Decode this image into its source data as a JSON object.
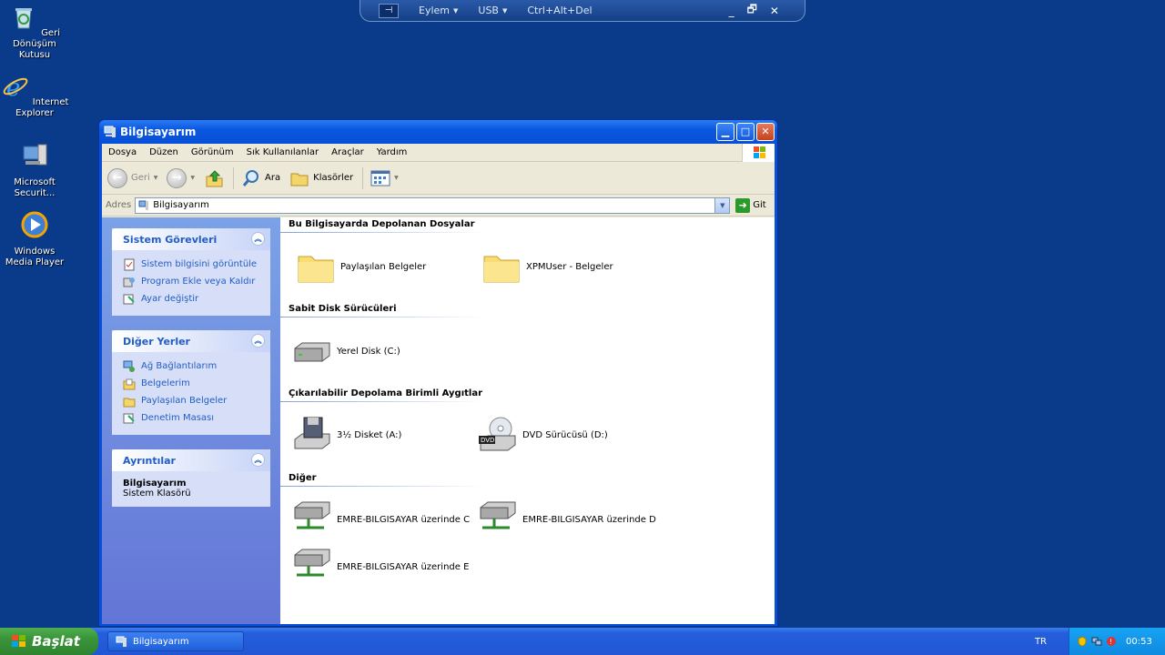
{
  "vm_toolbar": {
    "pin_label": "⊣",
    "menu_action": "Eylem",
    "menu_usb": "USB",
    "ctrl_alt_del": "Ctrl+Alt+Del",
    "min": "_",
    "restore": "🗗",
    "close": "✕"
  },
  "desktop_icons": [
    {
      "label": "Geri Dönüşüm Kutusu"
    },
    {
      "label": "Internet Explorer"
    },
    {
      "label": "Microsoft Securit..."
    },
    {
      "label": "Windows Media Player"
    }
  ],
  "window": {
    "title": "Bilgisayarım",
    "menu": [
      "Dosya",
      "Düzen",
      "Görünüm",
      "Sık Kullanılanlar",
      "Araçlar",
      "Yardım"
    ],
    "toolbar": {
      "back": "Geri",
      "search": "Ara",
      "folders": "Klasörler"
    },
    "address": {
      "label": "Adres",
      "value": "Bilgisayarım",
      "go": "Git"
    }
  },
  "taskpane": {
    "system_tasks": {
      "title": "Sistem Görevleri",
      "items": [
        "Sistem bilgisini görüntüle",
        "Program Ekle veya Kaldır",
        "Ayar değiştir"
      ]
    },
    "other_places": {
      "title": "Diğer Yerler",
      "items": [
        "Ağ Bağlantılarım",
        "Belgelerim",
        "Paylaşılan Belgeler",
        "Denetim Masası"
      ]
    },
    "details": {
      "title": "Ayrıntılar",
      "name": "Bilgisayarım",
      "type": "Sistem Klasörü"
    }
  },
  "content": {
    "groups": [
      {
        "title": "Bu Bilgisayarda Depolanan Dosyalar",
        "items": [
          "Paylaşılan Belgeler",
          "XPMUser - Belgeler"
        ]
      },
      {
        "title": "Sabit Disk Sürücüleri",
        "items": [
          "Yerel Disk (C:)"
        ]
      },
      {
        "title": "Çıkarılabilir Depolama Birimli Aygıtlar",
        "items": [
          "3½ Disket (A:)",
          "DVD Sürücüsü (D:)"
        ]
      },
      {
        "title": "Diğer",
        "items": [
          "EMRE-BILGISAYAR üzerinde C",
          "EMRE-BILGISAYAR üzerinde D",
          "EMRE-BILGISAYAR üzerinde E"
        ]
      }
    ]
  },
  "taskbar": {
    "start": "Başlat",
    "task": "Bilgisayarım",
    "lang": "TR",
    "clock": "00:53"
  }
}
